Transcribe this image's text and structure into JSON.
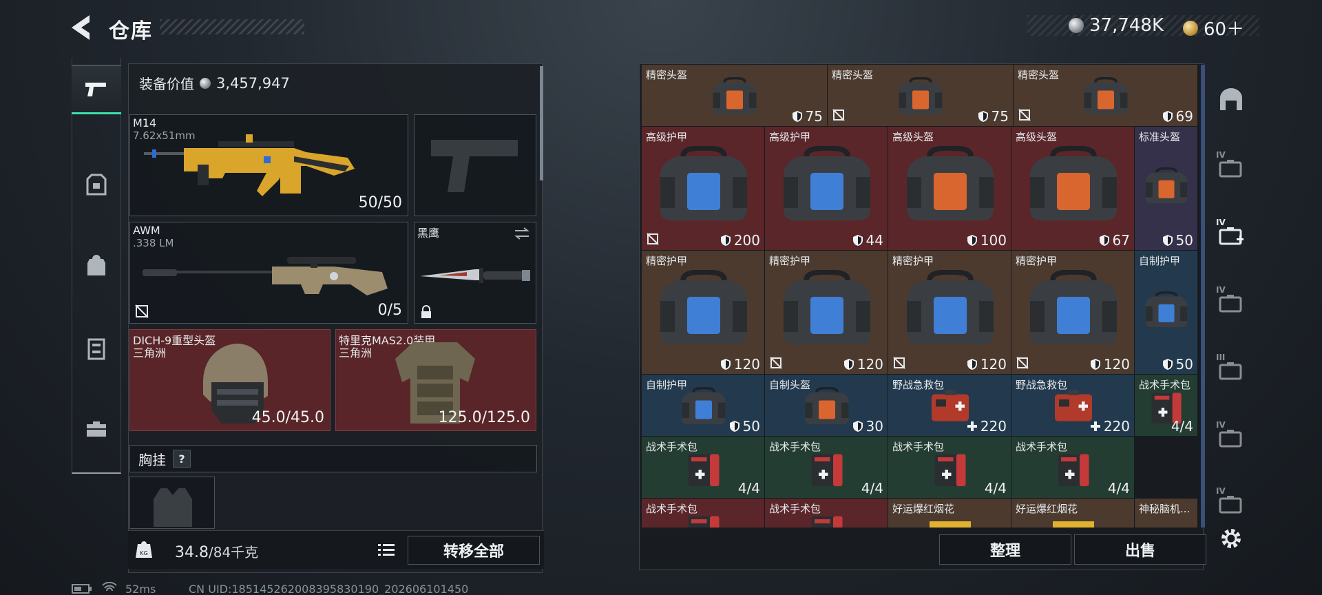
{
  "header": {
    "title": "仓库",
    "currency_silver": "37,748K",
    "currency_gold": "60＋"
  },
  "equipment": {
    "value_label": "装备价值",
    "value": "3,457,947",
    "primary": {
      "name": "M14",
      "caliber": "7.62x51mm",
      "ammo": "50/50"
    },
    "secondary": {
      "name": "AWM",
      "caliber": ".338 LM",
      "ammo": "0/5"
    },
    "melee": {
      "name": "黑鹰"
    },
    "helmet": {
      "name": "DICH-9重型头盔",
      "origin": "三角洲",
      "durability": "45.0/45.0"
    },
    "armor": {
      "name": "特里克MAS2.0装甲",
      "origin": "三角洲",
      "durability": "125.0/125.0"
    },
    "chest_rig": {
      "label": "胸挂",
      "help": "?"
    }
  },
  "bottom_bar": {
    "weight_current": "34.8",
    "weight_max": "/84千克",
    "transfer_all": "转移全部"
  },
  "storage": {
    "items": [
      {
        "name": "精密头盔",
        "value": "75",
        "tier": "brown",
        "icon": "shield-icon",
        "unrepairable": false
      },
      {
        "name": "精密头盔",
        "value": "75",
        "tier": "brown",
        "icon": "shield-icon",
        "unrepairable": true
      },
      {
        "name": "精密头盔",
        "value": "69",
        "tier": "brown",
        "icon": "shield-icon",
        "unrepairable": true
      },
      {
        "name": "高级护甲",
        "value": "200",
        "tier": "red",
        "icon": "shield-icon",
        "unrepairable": true
      },
      {
        "name": "高级护甲",
        "value": "44",
        "tier": "red",
        "icon": "shield-icon",
        "unrepairable": false
      },
      {
        "name": "高级头盔",
        "value": "100",
        "tier": "red",
        "icon": "shield-icon",
        "unrepairable": false
      },
      {
        "name": "高级头盔",
        "value": "67",
        "tier": "red",
        "icon": "shield-icon",
        "unrepairable": false
      },
      {
        "name": "标准头盔",
        "value": "50",
        "tier": "purple",
        "icon": "shield-icon",
        "unrepairable": false
      },
      {
        "name": "精密护甲",
        "value": "120",
        "tier": "brown",
        "icon": "shield-icon",
        "unrepairable": false
      },
      {
        "name": "精密护甲",
        "value": "120",
        "tier": "brown",
        "icon": "shield-icon",
        "unrepairable": true
      },
      {
        "name": "精密护甲",
        "value": "120",
        "tier": "brown",
        "icon": "shield-icon",
        "unrepairable": true
      },
      {
        "name": "精密护甲",
        "value": "120",
        "tier": "brown",
        "icon": "shield-icon",
        "unrepairable": true
      },
      {
        "name": "自制护甲",
        "value": "50",
        "tier": "blue",
        "icon": "shield-icon",
        "unrepairable": false
      },
      {
        "name": "自制护甲",
        "value": "50",
        "tier": "blue",
        "icon": "shield-icon",
        "unrepairable": false
      },
      {
        "name": "自制头盔",
        "value": "30",
        "tier": "blue",
        "icon": "shield-icon",
        "unrepairable": false
      },
      {
        "name": "野战急救包",
        "value": "220",
        "tier": "blue",
        "icon": "plus-icon",
        "unrepairable": false
      },
      {
        "name": "野战急救包",
        "value": "220",
        "tier": "blue",
        "icon": "plus-icon",
        "unrepairable": false
      },
      {
        "name": "战术手术包",
        "value": "4/4",
        "tier": "green",
        "icon": "",
        "unrepairable": false
      },
      {
        "name": "战术手术包",
        "value": "4/4",
        "tier": "green",
        "icon": "",
        "unrepairable": false
      },
      {
        "name": "战术手术包",
        "value": "4/4",
        "tier": "green",
        "icon": "",
        "unrepairable": false
      },
      {
        "name": "战术手术包",
        "value": "4/4",
        "tier": "green",
        "icon": "",
        "unrepairable": false
      },
      {
        "name": "战术手术包",
        "value": "4/4",
        "tier": "green",
        "icon": "",
        "unrepairable": false
      },
      {
        "name": "战术手术包",
        "value": "",
        "tier": "red",
        "icon": "",
        "unrepairable": false
      },
      {
        "name": "战术手术包",
        "value": "",
        "tier": "red",
        "icon": "",
        "unrepairable": false
      },
      {
        "name": "好运爆红烟花",
        "value": "",
        "tier": "brown",
        "icon": "",
        "unrepairable": false
      },
      {
        "name": "好运爆红烟花",
        "value": "",
        "tier": "brown",
        "icon": "",
        "unrepairable": false
      },
      {
        "name": "神秘脑机...",
        "value": "",
        "tier": "brown",
        "icon": "",
        "unrepairable": false
      }
    ],
    "sort_label": "整理",
    "sell_label": "出售"
  },
  "right_sidebar": {
    "tab_labels": [
      "IV",
      "IV",
      "IV",
      "III",
      "IV",
      "IV"
    ]
  },
  "status": {
    "ping": "52ms",
    "uid": "CN UID:185145262008395830190_202606101450"
  },
  "colors": {
    "accent": "#3ee0a9",
    "tier_brown": "#4c3a2e",
    "tier_red": "#5a2629",
    "tier_purple": "#35314a",
    "tier_blue": "#233a4e",
    "tier_green": "#243d33"
  }
}
